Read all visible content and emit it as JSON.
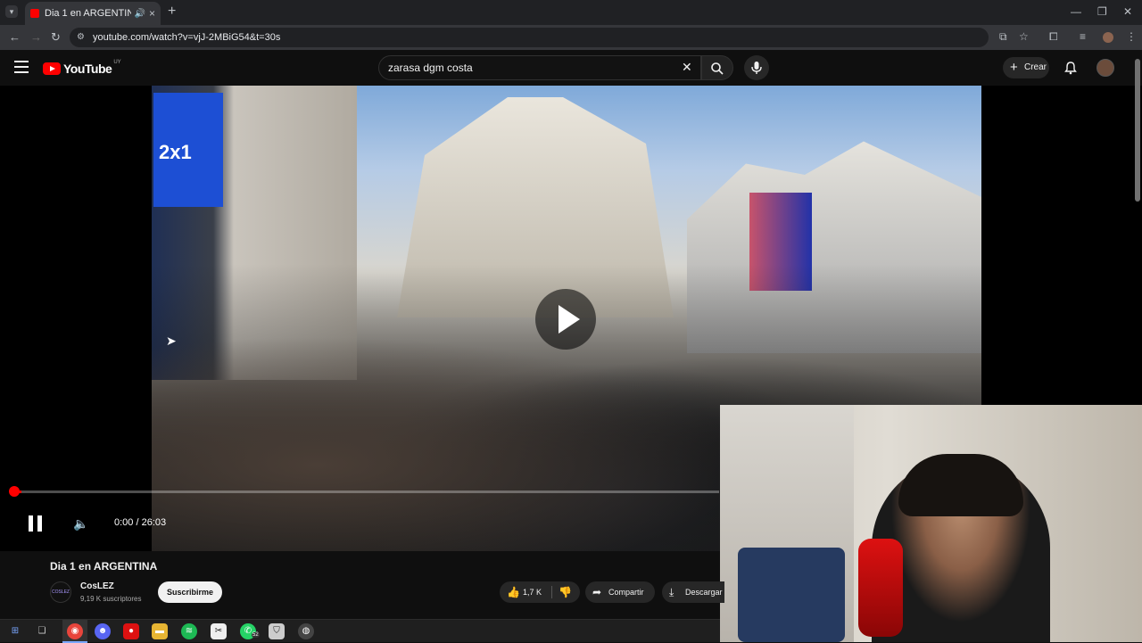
{
  "browser": {
    "tab_title": "Dia 1 en ARGENTINA - YouTube",
    "url": "youtube.com/watch?v=vjJ-2MBiG54&t=30s",
    "new_tab_symbol": "+",
    "close_symbol": "×"
  },
  "youtube": {
    "logo_text": "YouTube",
    "country_code": "UY",
    "search_query": "zarasa dgm costa",
    "create_label": "Crear"
  },
  "player": {
    "current_time": "0:00",
    "duration": "26:03",
    "time_display": "0:00 / 26:03",
    "progress": 0.0
  },
  "video": {
    "title": "Dia 1 en ARGENTINA",
    "billboard_text": "2x1",
    "channel_avatar_text": "COSLEZ",
    "channel_name": "CosLEZ",
    "subscribers": "9,19 K suscriptores",
    "subscribe_label": "Suscribirme",
    "likes": "1,7 K",
    "share_label": "Compartir",
    "download_label": "Descargar"
  },
  "taskbar": {
    "whatsapp_badge": "52"
  },
  "colors": {
    "accent": "#ff0000",
    "background": "#0f0f0f"
  }
}
